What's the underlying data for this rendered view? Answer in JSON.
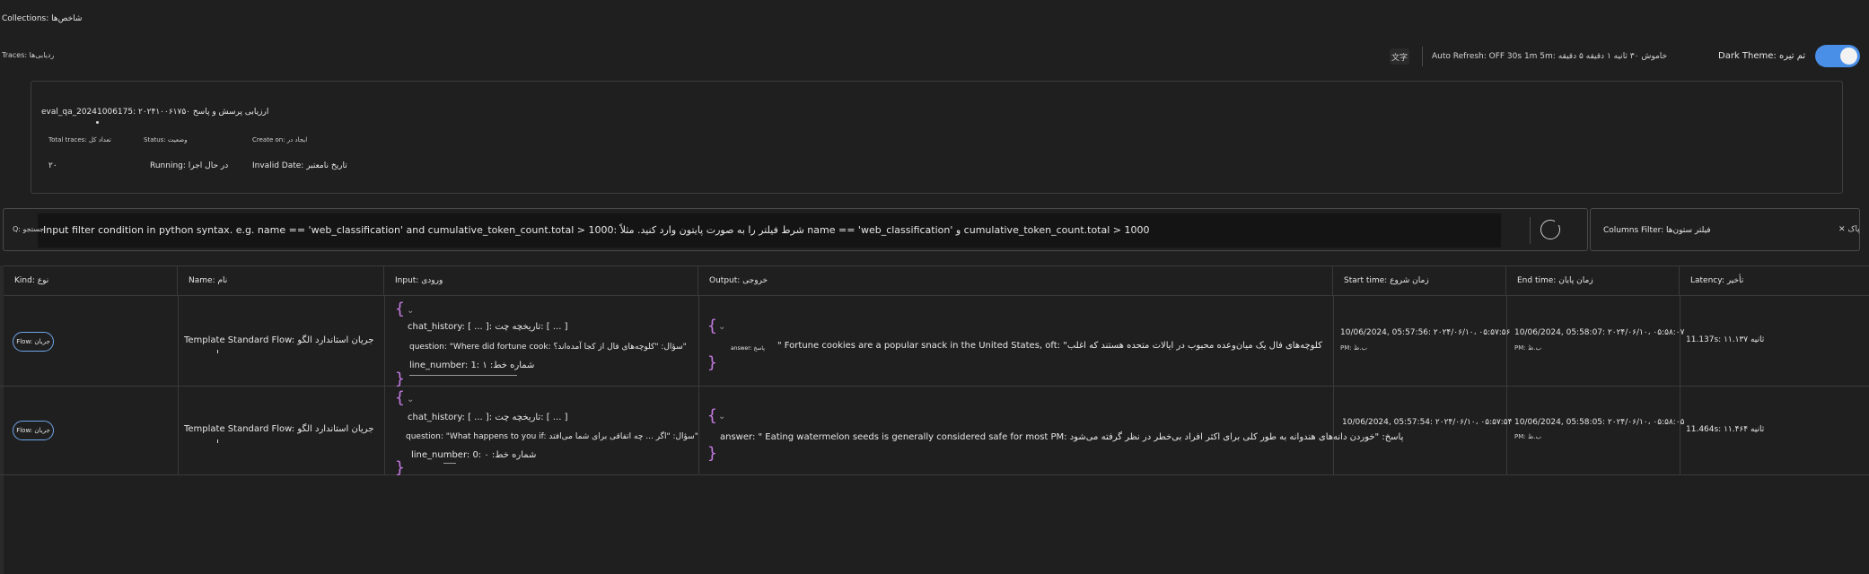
{
  "header": {
    "collections": "Collections: شاخص‌ها",
    "traces": "Traces: ردیابی‌ها",
    "lang_button": "文字",
    "auto_refresh": "Auto Refresh: OFF 30s 1m 5m: خاموش ۳۰ ثانیه ۱ دقیقه ۵ دقیقه",
    "dark_theme": "Dark Theme: تم تیره",
    "dark_theme_on": true
  },
  "summary": {
    "run_name": "eval_qa_20241006175: ۲۰۲۴۱۰۰۶۱۷۵۰ ارزیابی پرسش و پاسخ",
    "total_traces_label": "Total traces: تعداد کل",
    "total_traces_value": "۲۰",
    "status_label": "Status: وضعیت",
    "status_value": "Running: در حال اجرا",
    "create_on_label": "Create on: ایجاد در",
    "create_on_value": "Invalid Date: تاریخ نامعتبر"
  },
  "filter": {
    "icon": "Q: جستجو",
    "placeholder": "Input filter condition in python syntax. e.g. name == 'web_classification' and cumulative_token_count.total > 1000: شرط فیلتر را به صورت پایتون وارد کنید. مثلاً name == 'web_classification' و cumulative_token_count.total > 1000",
    "columns_filter": "Columns Filter: فیلتر ستون‌ها",
    "columns_clear": "✕ پاک"
  },
  "table": {
    "columns": [
      "Kind: نوع",
      "Name: نام",
      "Input: ورودی",
      "Output: خروجی",
      "Start time: زمان شروع",
      "End time: زمان پایان",
      "Latency: تأخیر"
    ],
    "rows": [
      {
        "kind": "Flow: جریان",
        "name": "Template Standard Flow: جریان استاندارد الگو",
        "input_chat_history": "chat_history: [ ... ]: تاریخچه چت: [ ... ]",
        "input_question": "question: \"Where did fortune cook: سؤال: \"کلوچه‌های فال از کجا آمده‌اند؟\"",
        "input_line": "line_number: 1: شماره خط: ۱",
        "output_key": "answer: پاسخ",
        "output": "\" Fortune cookies are a popular snack in the United States, oft: \"کلوچه‌های فال یک میان‌وعده محبوب در ایالات متحده هستند که اغلب",
        "start_time": "10/06/2024, 05:57:56: ۲۰۲۴/۰۶/۱۰، ۰۵:۵۷:۵۶",
        "start_ampm": "PM: ب.ظ",
        "end_time": "10/06/2024, 05:58:07: ۲۰۲۴/۰۶/۱۰، ۰۵:۵۸:۰۷",
        "end_ampm": "PM: ب.ظ",
        "latency": "11.137s: ۱۱.۱۳۷ ثانیه"
      },
      {
        "kind": "Flow: جریان",
        "name": "Template Standard Flow: جریان استاندارد الگو",
        "input_chat_history": "chat_history: [ ... ]: تاریخچه چت: [ ... ]",
        "input_question": "question: \"What happens to you if: سؤال: \"اگر ... چه اتفاقی برای شما می‌افتد\"",
        "input_line": "line_number: 0: شماره خط: ۰",
        "output": "answer: \" Eating watermelon seeds is generally considered safe for most PM: پاسخ: \"خوردن دانه‌های هندوانه به طور کلی برای اکثر افراد بی‌خطر در نظر گرفته می‌شود",
        "start_time": "10/06/2024, 05:57:54: ۲۰۲۴/۰۶/۱۰، ۰۵:۵۷:۵۴",
        "end_time": "10/06/2024, 05:58:05: ۲۰۲۴/۰۶/۱۰، ۰۵:۵۸:۰۵",
        "end_ampm": "PM: ب.ظ",
        "latency": "11.464s: ۱۱.۴۶۴ ثانیه"
      }
    ]
  },
  "colors": {
    "background": "#1f1f1f",
    "accent": "#4a8fe7",
    "brace": "#c27ae0",
    "border": "#3a3a3a"
  }
}
